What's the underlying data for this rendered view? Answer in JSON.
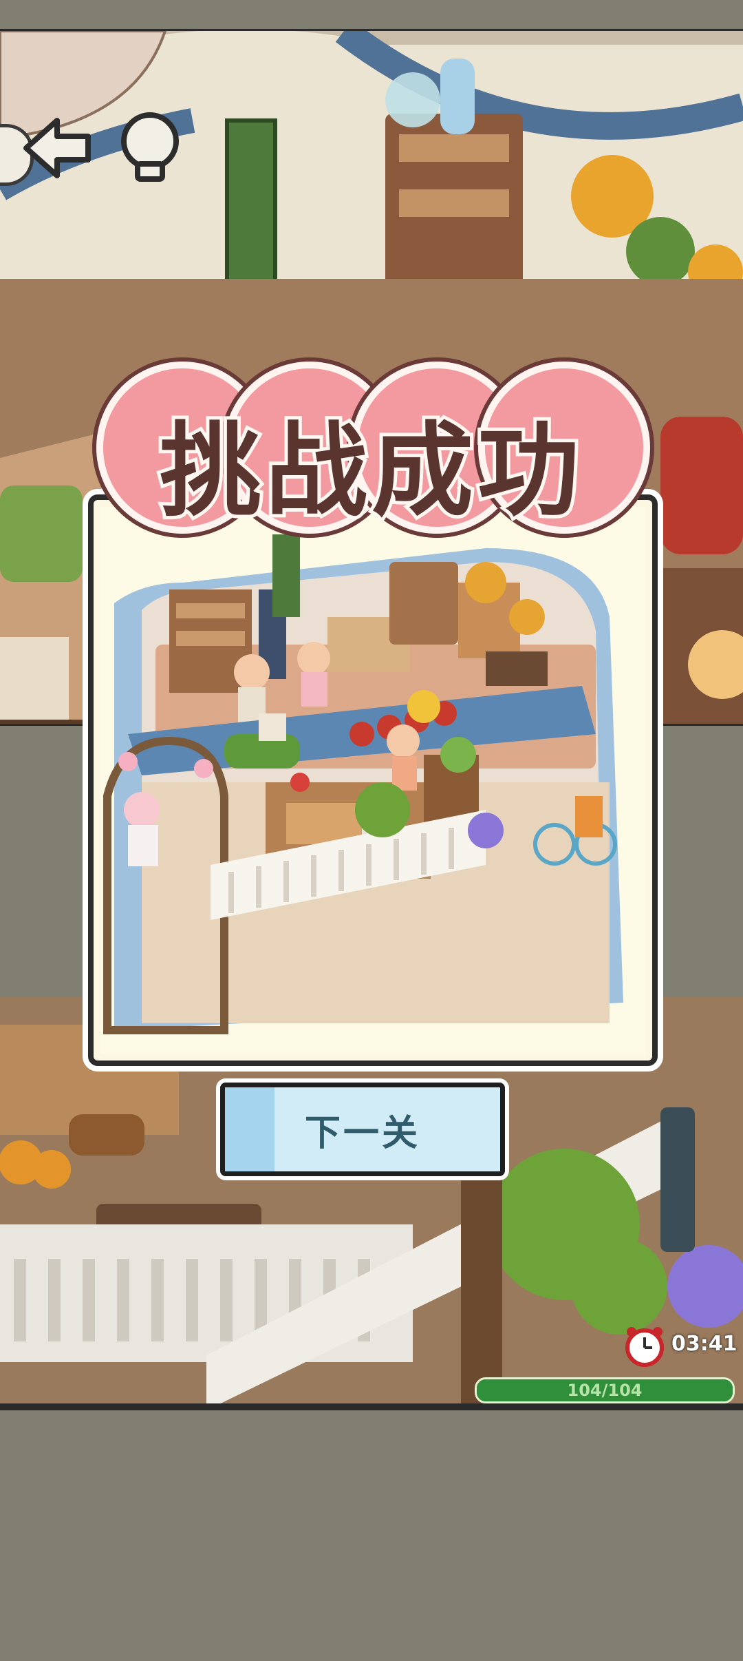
{
  "header": {
    "back_icon": "arrow-left-icon",
    "hint_icon": "lightbulb-icon"
  },
  "result": {
    "title": "挑战成功",
    "next_button_label": "下一关"
  },
  "status": {
    "timer_icon": "alarm-clock-icon",
    "timer": "03:41",
    "progress_text": "104/104",
    "progress_fraction": 1.0
  },
  "colors": {
    "title_bubble": "#f29aa0",
    "title_text": "#5a3530",
    "button_bg": "#d2ecf7",
    "button_text": "#2f5b6a",
    "progress_fill": "#2f8f3b"
  }
}
